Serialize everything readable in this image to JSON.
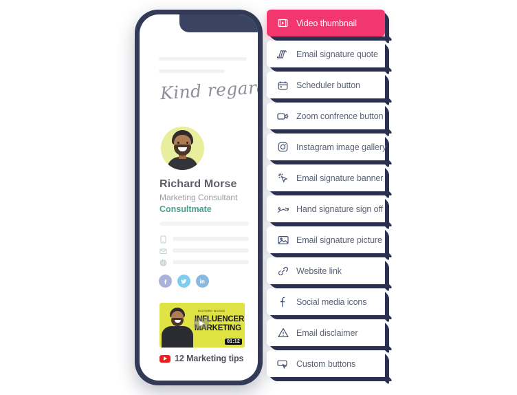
{
  "phone": {
    "signoff": "Kind regards,",
    "profile": {
      "name": "Richard Morse",
      "role": "Marketing Consultant",
      "company": "Consultmate",
      "company_color": "#4aa08f",
      "avatar_alt": "avatar-photo"
    },
    "contact_rows": [
      {
        "icon": "phone-icon",
        "value": ""
      },
      {
        "icon": "email-icon",
        "value": ""
      },
      {
        "icon": "globe-icon",
        "value": ""
      }
    ],
    "social": [
      {
        "icon": "facebook-icon",
        "color": "#a9b3d9"
      },
      {
        "icon": "twitter-icon",
        "color": "#7ecdf1"
      },
      {
        "icon": "linkedin-icon",
        "color": "#8bb8dd"
      }
    ],
    "video": {
      "overline": "RICHARD MORSE",
      "headline_line1": "INFLUENCER",
      "headline_line2": "MARKETING",
      "duration": "01:12",
      "caption": "12 Marketing tips",
      "platform_icon": "youtube-icon",
      "thumb_bg": "#dfe243"
    }
  },
  "menu": {
    "active_color": "#f2376e",
    "items": [
      {
        "label": "Video thumbnail",
        "icon": "video-thumbnail-icon",
        "active": true
      },
      {
        "label": "Email signature quote",
        "icon": "quote-icon",
        "active": false
      },
      {
        "label": "Scheduler button",
        "icon": "calendar-icon",
        "active": false
      },
      {
        "label": "Zoom confrence button",
        "icon": "videocam-icon",
        "active": false
      },
      {
        "label": "Instagram image gallery",
        "icon": "instagram-icon",
        "active": false
      },
      {
        "label": "Email signature banner",
        "icon": "cursor-sparkle-icon",
        "active": false
      },
      {
        "label": "Hand signature sign off",
        "icon": "signature-icon",
        "active": false
      },
      {
        "label": "Email signature picture",
        "icon": "image-icon",
        "active": false
      },
      {
        "label": "Website link",
        "icon": "link-icon",
        "active": false
      },
      {
        "label": "Social media icons",
        "icon": "facebook-glyph-icon",
        "active": false
      },
      {
        "label": "Email disclaimer",
        "icon": "warning-icon",
        "active": false
      },
      {
        "label": "Custom buttons",
        "icon": "custom-button-icon",
        "active": false
      }
    ]
  }
}
